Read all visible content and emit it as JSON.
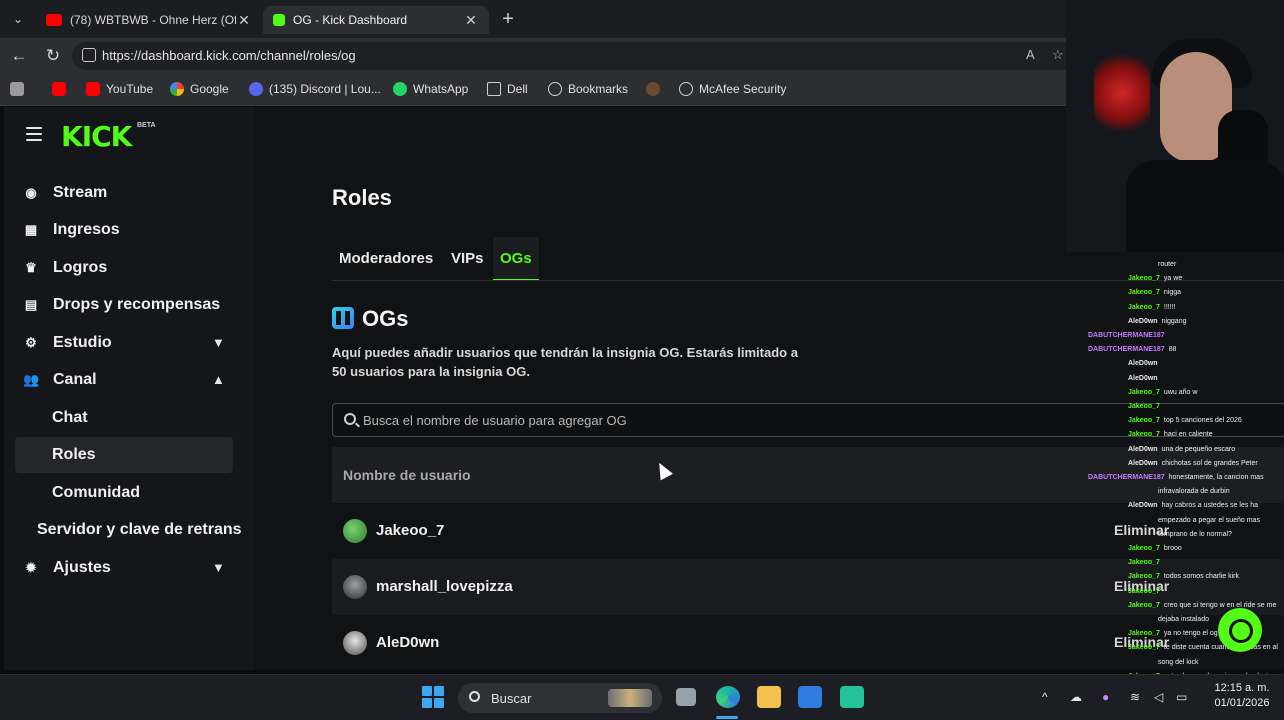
{
  "browser": {
    "tabs": [
      {
        "title": "(78) WBTBWB - Ohne Herz (Officia",
        "icon": "youtube-icon",
        "active": false
      },
      {
        "title": "OG - Kick Dashboard",
        "icon": "kick-icon",
        "active": true
      }
    ],
    "url": "https://dashboard.kick.com/channel/roles/og",
    "bookmarks": [
      {
        "label": "YouTube",
        "icon": "youtube-icon"
      },
      {
        "label": "Google",
        "icon": "google-icon"
      },
      {
        "label": "(135) Discord | Lou...",
        "icon": "discord-icon"
      },
      {
        "label": "WhatsApp",
        "icon": "whatsapp-icon"
      },
      {
        "label": "Dell",
        "icon": "folder-icon"
      },
      {
        "label": "Bookmarks",
        "icon": "globe-icon"
      },
      {
        "label": "McAfee Security",
        "icon": "globe-icon"
      }
    ]
  },
  "sidebar": {
    "logo": "KICK",
    "beta": "BETA",
    "items": [
      {
        "label": "Stream",
        "icon": "broadcast-icon"
      },
      {
        "label": "Ingresos",
        "icon": "chart-icon"
      },
      {
        "label": "Logros",
        "icon": "trophy-icon"
      },
      {
        "label": "Drops y recompensas",
        "icon": "gift-icon"
      },
      {
        "label": "Estudio",
        "icon": "studio-icon"
      },
      {
        "label": "Canal",
        "icon": "users-icon"
      },
      {
        "label": "Ajustes",
        "icon": "gear-icon"
      }
    ],
    "subitems": [
      "Chat",
      "Roles",
      "Comunidad",
      "Servidor y clave de retrans"
    ],
    "active_subitem": "Roles"
  },
  "main": {
    "title": "Roles",
    "tabs": [
      "Moderadores",
      "VIPs",
      "OGs"
    ],
    "active_tab": "OGs",
    "section_title": "OGs",
    "description": "Aquí puedes añadir usuarios que tendrán la insignia OG. Estarás limitado a 50 usuarios para la insignia OG.",
    "search_placeholder": "Busca el nombre de usuario para agregar OG",
    "table_header": "Nombre de usuario",
    "rows": [
      {
        "username": "Jakeoo_7",
        "action": "Eliminar"
      },
      {
        "username": "marshall_lovepizza",
        "action": "Eliminar"
      },
      {
        "username": "AleD0wn",
        "action": "Eliminar"
      }
    ]
  },
  "chat": [
    {
      "user": "",
      "text": "router",
      "color": "w"
    },
    {
      "user": "Jakeoo_7",
      "text": "ya we",
      "color": "g"
    },
    {
      "user": "Jakeoo_7",
      "text": "nigga",
      "color": "g"
    },
    {
      "user": "Jakeoo_7",
      "text": "!!!!!!",
      "color": "g"
    },
    {
      "user": "AleD0wn",
      "text": "niggang",
      "color": "w"
    },
    {
      "user": "DABUTCHERMANE187",
      "text": "",
      "color": "p"
    },
    {
      "user": "DABUTCHERMANE187",
      "text": "88",
      "color": "p"
    },
    {
      "user": "AleD0wn",
      "text": "",
      "color": "w"
    },
    {
      "user": "AleD0wn",
      "text": "",
      "color": "w"
    },
    {
      "user": "Jakeoo_7",
      "text": "uwu año w",
      "color": "g"
    },
    {
      "user": "Jakeoo_7",
      "text": "",
      "color": "g"
    },
    {
      "user": "Jakeoo_7",
      "text": "top 5 canciones del 2026",
      "color": "g"
    },
    {
      "user": "Jakeoo_7",
      "text": "haci en caliente",
      "color": "g"
    },
    {
      "user": "AleD0wn",
      "text": "una de pequeño escaro",
      "color": "w"
    },
    {
      "user": "AleD0wn",
      "text": "chichotas sol de grandes Peter",
      "color": "w"
    },
    {
      "user": "DABUTCHERMANE187",
      "text": "honestamente, la cancion mas",
      "color": "p"
    },
    {
      "user": "",
      "text": "infravalorada de durbin",
      "color": "w"
    },
    {
      "user": "AleD0wn",
      "text": "hay cabros a ustedes se les ha",
      "color": "w"
    },
    {
      "user": "",
      "text": "empezado a pegar el sueño mas",
      "color": "w"
    },
    {
      "user": "",
      "text": "temprano de lo normal?",
      "color": "w"
    },
    {
      "user": "Jakeoo_7",
      "text": "brooo",
      "color": "g"
    },
    {
      "user": "Jakeoo_7",
      "text": "",
      "color": "g"
    },
    {
      "user": "Jakeoo_7",
      "text": "todos somos charlie kirk",
      "color": "g"
    },
    {
      "user": "Jakeoo_7",
      "text": "",
      "color": "g"
    },
    {
      "user": "Jakeoo_7",
      "text": "creo que si tengo w en el ride se me",
      "color": "g"
    },
    {
      "user": "",
      "text": "dejaba instalado",
      "color": "w"
    },
    {
      "user": "Jakeoo_7",
      "text": "ya no tengo el og",
      "color": "g"
    },
    {
      "user": "Jakeoo_7",
      "text": "te diste cuenta cuando estabas en al",
      "color": "g"
    },
    {
      "user": "",
      "text": "song del kick",
      "color": "w"
    },
    {
      "user": "Jakeoo_7",
      "text": "estoy buscando un juego de electores",
      "color": "g"
    }
  ],
  "taskbar": {
    "search_label": "Buscar",
    "time": "12:15 a. m.",
    "date": "01/01/2026"
  }
}
